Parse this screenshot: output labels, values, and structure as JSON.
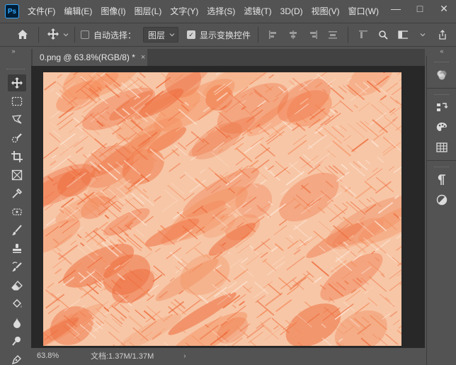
{
  "app": {
    "logo_text": "Ps",
    "menu": [
      "文件(F)",
      "编辑(E)",
      "图像(I)",
      "图层(L)",
      "文字(Y)",
      "选择(S)",
      "滤镜(T)",
      "3D(D)",
      "视图(V)",
      "窗口(W)"
    ],
    "window_controls": {
      "minimize": "—",
      "restore": "□",
      "close": "✕"
    }
  },
  "options_bar": {
    "auto_select_label": "自动选择：",
    "auto_select_checked": false,
    "layer_select_value": "图层",
    "show_transform_label": "显示变换控件",
    "show_transform_checked": true
  },
  "document": {
    "tab_title": "0.png @ 63.8%(RGB/8) *",
    "close_glyph": "×"
  },
  "status": {
    "zoom": "63.8%",
    "doc_info": "文档:1.37M/1.37M",
    "arrow": "›"
  },
  "colors": {
    "canvas_base": "#f7c6a6",
    "stroke_dark": "#ee6a3a",
    "stroke_mid": "#f58e5e",
    "stroke_light": "#fde6d6"
  }
}
